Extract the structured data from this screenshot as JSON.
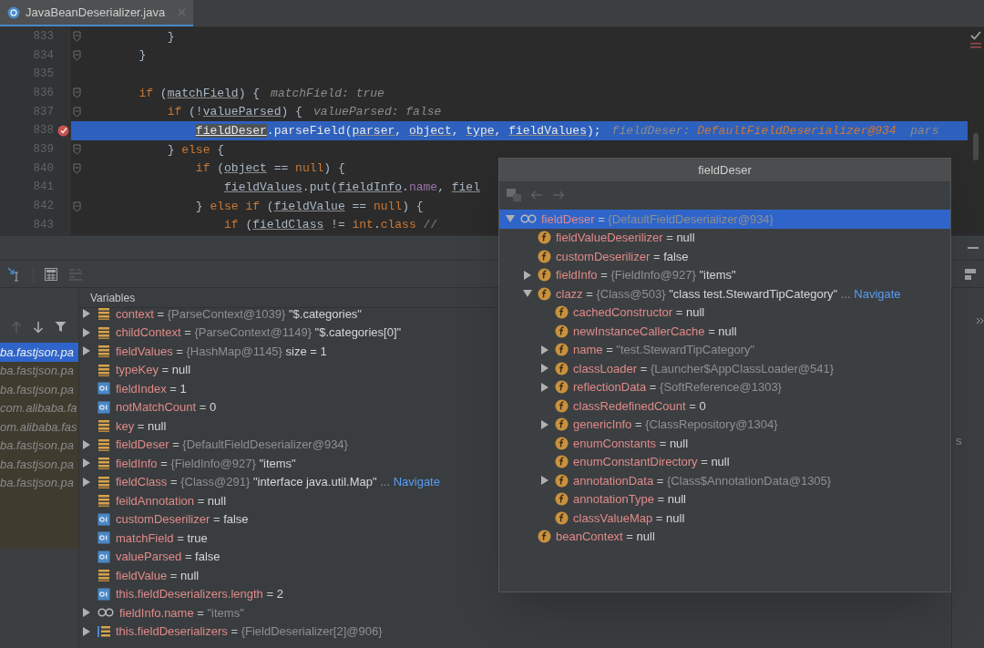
{
  "editor_tab": {
    "title": "JavaBeanDeserializer.java",
    "selected": true
  },
  "code_lines": [
    {
      "number": "833",
      "fold": true,
      "breakpoint": false,
      "current": false,
      "segments": [
        {
          "t": "            }",
          "kind": "plain"
        }
      ]
    },
    {
      "number": "834",
      "fold": true,
      "breakpoint": false,
      "current": false,
      "segments": [
        {
          "t": "        }",
          "kind": "plain"
        }
      ]
    },
    {
      "number": "835",
      "fold": false,
      "breakpoint": false,
      "current": false
    },
    {
      "number": "836",
      "fold": true,
      "breakpoint": false,
      "current": false,
      "segments": [
        {
          "t": "        if",
          "kind": "keyword"
        },
        {
          "t": " (",
          "kind": "plain"
        },
        {
          "t": "matchField",
          "kind": "var"
        },
        {
          "t": ") {",
          "kind": "plain"
        }
      ],
      "hint": [
        {
          "t": "matchField: true",
          "kind": "label"
        }
      ]
    },
    {
      "number": "837",
      "fold": true,
      "breakpoint": false,
      "current": false,
      "segments": [
        {
          "t": "            if",
          "kind": "keyword"
        },
        {
          "t": " (!",
          "kind": "plain"
        },
        {
          "t": "valueParsed",
          "kind": "var"
        },
        {
          "t": ") {",
          "kind": "plain"
        }
      ],
      "hint": [
        {
          "t": "valueParsed: false",
          "kind": "label"
        }
      ]
    },
    {
      "number": "838",
      "fold": false,
      "breakpoint": true,
      "current": true,
      "segments": [
        {
          "t": "                fieldDeser",
          "kind": "var_hl"
        },
        {
          "t": ".parseField(",
          "kind": "plain"
        },
        {
          "t": "parser",
          "kind": "var"
        },
        {
          "t": ", ",
          "kind": "plain"
        },
        {
          "t": "object",
          "kind": "var"
        },
        {
          "t": ", ",
          "kind": "plain"
        },
        {
          "t": "type",
          "kind": "var"
        },
        {
          "t": ", ",
          "kind": "plain"
        },
        {
          "t": "fieldValues",
          "kind": "var"
        },
        {
          "t": ");",
          "kind": "plain"
        }
      ],
      "hint": [
        {
          "t": "fieldDeser: ",
          "kind": "label"
        },
        {
          "t": "DefaultFieldDeserializer@934",
          "kind": "value"
        },
        {
          "t": "  pars",
          "kind": "label"
        }
      ]
    },
    {
      "number": "839",
      "fold": true,
      "breakpoint": false,
      "current": false,
      "segments": [
        {
          "t": "            } ",
          "kind": "plain"
        },
        {
          "t": "else",
          "kind": "keyword"
        },
        {
          "t": " {",
          "kind": "plain"
        }
      ]
    },
    {
      "number": "840",
      "fold": true,
      "breakpoint": false,
      "current": false,
      "segments": [
        {
          "t": "                if",
          "kind": "keyword"
        },
        {
          "t": " (",
          "kind": "plain"
        },
        {
          "t": "object",
          "kind": "var"
        },
        {
          "t": " == ",
          "kind": "plain"
        },
        {
          "t": "null",
          "kind": "keyword"
        },
        {
          "t": ") {",
          "kind": "plain"
        }
      ]
    },
    {
      "number": "841",
      "fold": false,
      "breakpoint": false,
      "current": false,
      "segments": [
        {
          "t": "                    fieldValues",
          "kind": "var"
        },
        {
          "t": ".put(",
          "kind": "plain"
        },
        {
          "t": "fieldInfo",
          "kind": "var"
        },
        {
          "t": ".",
          "kind": "plain"
        },
        {
          "t": "name",
          "kind": "field"
        },
        {
          "t": ", ",
          "kind": "plain"
        },
        {
          "t": "fiel",
          "kind": "var"
        }
      ]
    },
    {
      "number": "842",
      "fold": true,
      "breakpoint": false,
      "current": false,
      "segments": [
        {
          "t": "                } ",
          "kind": "plain"
        },
        {
          "t": "else if",
          "kind": "keyword"
        },
        {
          "t": " (",
          "kind": "plain"
        },
        {
          "t": "fieldValue",
          "kind": "var"
        },
        {
          "t": " == ",
          "kind": "plain"
        },
        {
          "t": "null",
          "kind": "keyword"
        },
        {
          "t": ") {",
          "kind": "plain"
        }
      ]
    },
    {
      "number": "843",
      "fold": false,
      "breakpoint": false,
      "current": false,
      "segments": [
        {
          "t": "                    if",
          "kind": "keyword"
        },
        {
          "t": " (",
          "kind": "plain"
        },
        {
          "t": "fieldClass",
          "kind": "var"
        },
        {
          "t": " != ",
          "kind": "plain"
        },
        {
          "t": "int",
          "kind": "keyword"
        },
        {
          "t": ".",
          "kind": "plain"
        },
        {
          "t": "class",
          "kind": "keyword"
        },
        {
          "t": " //",
          "kind": "comment"
        }
      ]
    }
  ],
  "frames": [
    {
      "label": "ba.fastjson.pa",
      "selected": true
    },
    {
      "label": "ba.fastjson.pa",
      "selected": false
    },
    {
      "label": "ba.fastjson.pa",
      "selected": false
    },
    {
      "label": "com.alibaba.fa",
      "selected": false
    },
    {
      "label": "om.alibaba.fas",
      "selected": false
    },
    {
      "label": "ba.fastjson.pa",
      "selected": false
    },
    {
      "label": "ba.fastjson.pa",
      "selected": false
    },
    {
      "label": "ba.fastjson.pa",
      "selected": false
    }
  ],
  "variables_title": "Variables",
  "variables": [
    {
      "kind": "object",
      "name": "context",
      "op": "=",
      "expanded": false,
      "selected": false,
      "ref": "{ParseContext@1039}",
      "value": "\"$.categories\""
    },
    {
      "kind": "object",
      "name": "childContext",
      "op": "=",
      "expanded": false,
      "selected": false,
      "ref": "{ParseContext@1149}",
      "value": "\"$.categories[0]\""
    },
    {
      "kind": "object",
      "name": "fieldValues",
      "op": "=",
      "expanded": false,
      "selected": false,
      "ref": "{HashMap@1145}",
      "value": "size = 1"
    },
    {
      "kind": "object",
      "name": "typeKey",
      "op": "=",
      "selected": false,
      "value": "null"
    },
    {
      "kind": "primitive",
      "name": "fieldIndex",
      "op": "=",
      "selected": false,
      "value": "1"
    },
    {
      "kind": "primitive",
      "name": "notMatchCount",
      "op": "=",
      "selected": false,
      "value": "0"
    },
    {
      "kind": "object",
      "name": "key",
      "op": "=",
      "selected": false,
      "value": "null"
    },
    {
      "kind": "object",
      "name": "fieldDeser",
      "op": "=",
      "expanded": false,
      "selected": false,
      "ref": "{DefaultFieldDeserializer@934}"
    },
    {
      "kind": "object",
      "name": "fieldInfo",
      "op": "=",
      "expanded": false,
      "selected": false,
      "ref": "{FieldInfo@927}",
      "value": "\"items\""
    },
    {
      "kind": "object",
      "name": "fieldClass",
      "op": "=",
      "expanded": false,
      "selected": false,
      "ref": "{Class@291}",
      "value": "\"interface java.util.Map\"",
      "more": "...",
      "link": "Navigate"
    },
    {
      "kind": "object",
      "name": "feildAnnotation",
      "op": "=",
      "selected": false,
      "value": "null"
    },
    {
      "kind": "primitive",
      "name": "customDeserilizer",
      "op": "=",
      "selected": false,
      "value": "false"
    },
    {
      "kind": "primitive",
      "name": "matchField",
      "op": "=",
      "selected": false,
      "value": "true"
    },
    {
      "kind": "primitive",
      "name": "valueParsed",
      "op": "=",
      "selected": false,
      "value": "false"
    },
    {
      "kind": "object",
      "name": "fieldValue",
      "op": "=",
      "selected": false,
      "value": "null"
    },
    {
      "kind": "primitive",
      "name": "this.fieldDeserializers.length",
      "op": "=",
      "selected": false,
      "value": "2"
    },
    {
      "kind": "watch",
      "name": "fieldInfo.name",
      "op": "=",
      "expanded": false,
      "selected": false,
      "ref": "\"items\""
    },
    {
      "kind": "array",
      "name": "this.fieldDeserializers",
      "op": "=",
      "expanded": false,
      "selected": false,
      "ref": "{FieldDeserializer[2]@906}"
    }
  ],
  "side_fragment": "s",
  "popup": {
    "title": "fieldDeser",
    "tree": [
      {
        "kind": "watch",
        "name": "fieldDeser",
        "op": "=",
        "expanded": true,
        "selected": true,
        "ref": "{DefaultFieldDeserializer@934}",
        "children": [
          {
            "kind": "field",
            "name": "fieldValueDeserilizer",
            "op": "=",
            "selected": false,
            "value": "null"
          },
          {
            "kind": "field",
            "name": "customDeserilizer",
            "op": "=",
            "selected": false,
            "value": "false"
          },
          {
            "kind": "field",
            "name": "fieldInfo",
            "op": "=",
            "expanded": false,
            "selected": false,
            "ref": "{FieldInfo@927}",
            "value": "\"items\""
          },
          {
            "kind": "field",
            "name": "clazz",
            "op": "=",
            "expanded": true,
            "selected": false,
            "ref": "{Class@503}",
            "value": "\"class test.StewardTipCategory\"",
            "more": "...",
            "link": "Navigate",
            "children": [
              {
                "kind": "field",
                "name": "cachedConstructor",
                "op": "=",
                "selected": false,
                "value": "null"
              },
              {
                "kind": "field",
                "name": "newInstanceCallerCache",
                "op": "=",
                "selected": false,
                "value": "null"
              },
              {
                "kind": "field",
                "name": "name",
                "op": "=",
                "expanded": false,
                "selected": false,
                "ref": "\"test.StewardTipCategory\""
              },
              {
                "kind": "field",
                "name": "classLoader",
                "op": "=",
                "expanded": false,
                "selected": false,
                "ref": "{Launcher$AppClassLoader@541}"
              },
              {
                "kind": "field",
                "name": "reflectionData",
                "op": "=",
                "expanded": false,
                "selected": false,
                "ref": "{SoftReference@1303}"
              },
              {
                "kind": "field",
                "name": "classRedefinedCount",
                "op": "=",
                "selected": false,
                "value": "0"
              },
              {
                "kind": "field",
                "name": "genericInfo",
                "op": "=",
                "expanded": false,
                "selected": false,
                "ref": "{ClassRepository@1304}"
              },
              {
                "kind": "field",
                "name": "enumConstants",
                "op": "=",
                "selected": false,
                "value": "null"
              },
              {
                "kind": "field",
                "name": "enumConstantDirectory",
                "op": "=",
                "selected": false,
                "value": "null"
              },
              {
                "kind": "field",
                "name": "annotationData",
                "op": "=",
                "expanded": false,
                "selected": false,
                "ref": "{Class$AnnotationData@1305}"
              },
              {
                "kind": "field",
                "name": "annotationType",
                "op": "=",
                "selected": false,
                "value": "null"
              },
              {
                "kind": "field",
                "name": "classValueMap",
                "op": "=",
                "selected": false,
                "value": "null"
              }
            ]
          },
          {
            "kind": "field",
            "name": "beanContext",
            "op": "=",
            "selected": false,
            "value": "null"
          }
        ]
      }
    ]
  }
}
